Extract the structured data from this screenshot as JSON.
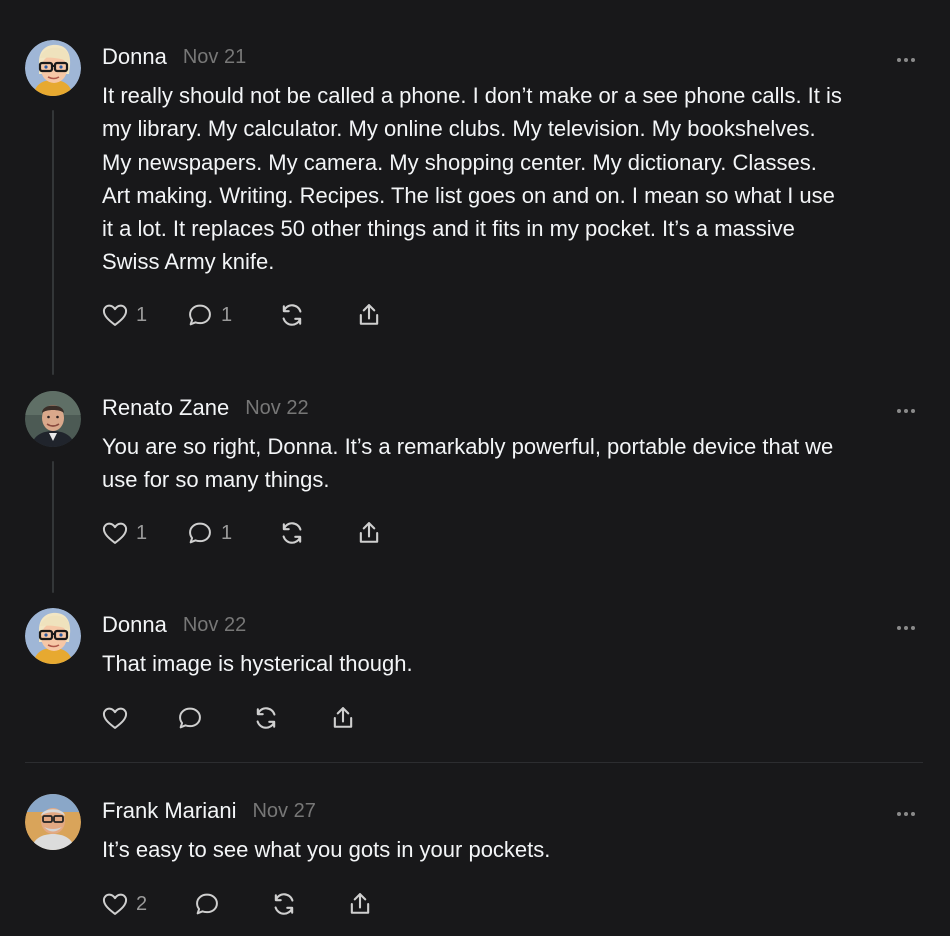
{
  "posts": [
    {
      "author": "Donna",
      "date": "Nov 21",
      "avatar": "avatar-cartoon-glasses",
      "lines": [
        "It really should not be called a phone. I don’t make or a see phone calls. It is",
        "my library. My calculator. My online clubs. My television. My bookshelves.",
        "My newspapers. My camera. My shopping center. My dictionary. Classes.",
        "Art making. Writing. Recipes. The list goes on and on. I mean so what I use",
        "it a lot. It replaces 50 other things and it fits in my pocket. It’s a massive",
        "Swiss Army knife."
      ],
      "likes": "1",
      "replies": "1"
    },
    {
      "author": "Renato Zane",
      "date": "Nov 22",
      "avatar": "avatar-photo-man",
      "lines": [
        "You are so right, Donna. It’s a remarkably powerful, portable device that we",
        "use for so many things."
      ],
      "likes": "1",
      "replies": "1"
    },
    {
      "author": "Donna",
      "date": "Nov 22",
      "avatar": "avatar-cartoon-glasses",
      "lines": [
        "That image is hysterical though."
      ],
      "likes": "",
      "replies": ""
    },
    {
      "author": "Frank Mariani",
      "date": "Nov 27",
      "avatar": "avatar-photo-man-glasses",
      "lines": [
        "It’s easy to see what you gots in your pockets."
      ],
      "likes": "2",
      "replies": ""
    }
  ],
  "icons": {
    "like": "heart-icon",
    "reply": "comment-bubble-icon",
    "repost": "repost-icon",
    "share": "share-icon",
    "more": "more-horizontal-icon"
  },
  "colors": {
    "background": "#18181a",
    "text": "#f3f5f7",
    "secondary": "#777777",
    "icon": "#cfcfcf",
    "thread_line": "#333638"
  }
}
